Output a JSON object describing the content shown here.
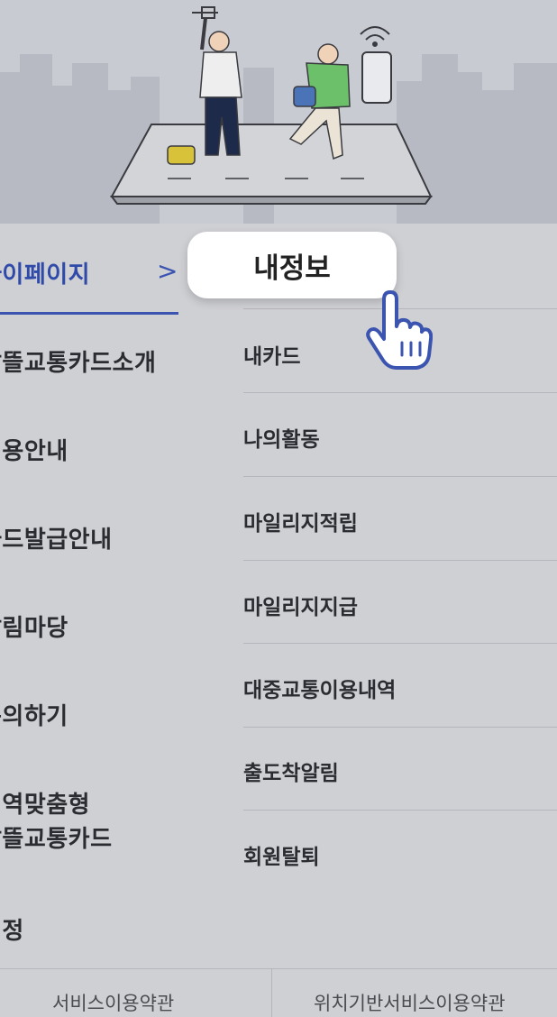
{
  "left_menu": {
    "items": [
      {
        "label": "마이페이지",
        "active": true
      },
      {
        "label": "알뜰교통카드소개"
      },
      {
        "label": "이용안내"
      },
      {
        "label": "카드발급안내"
      },
      {
        "label": "알림마당"
      },
      {
        "label": "문의하기"
      },
      {
        "label": "지역맞춤형",
        "label2": "알뜰교통카드"
      },
      {
        "label": "설정"
      }
    ],
    "chevron": ">"
  },
  "sub_menu": {
    "highlighted": "내정보",
    "items": [
      "내카드",
      "나의활동",
      "마일리지적립",
      "마일리지지급",
      "대중교통이용내역",
      "출도착알림",
      "회원탈퇴"
    ]
  },
  "footer": {
    "terms": "서비스이용약관",
    "location_terms": "위치기반서비스이용약관"
  },
  "colors": {
    "accent": "#3b54b0",
    "background": "#cfd0d4"
  },
  "icons": [
    "pointing-hand-icon",
    "chevron-right-icon",
    "wifi-signal-icon"
  ]
}
